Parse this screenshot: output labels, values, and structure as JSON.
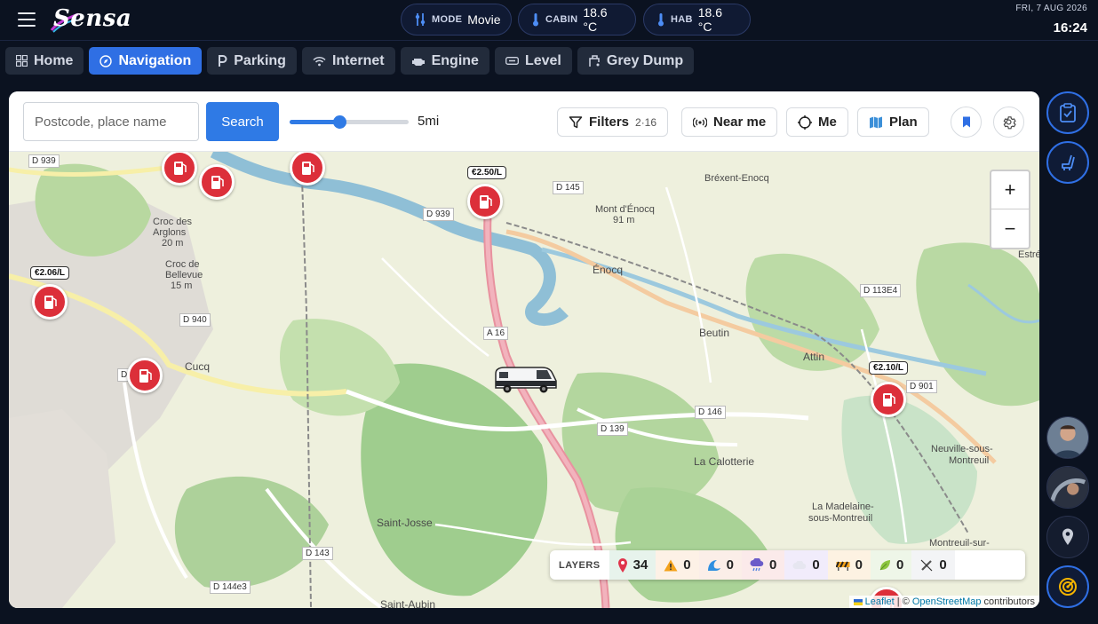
{
  "app": {
    "logo_text": "Sensa"
  },
  "status": {
    "mode_label": "MODE",
    "mode_value": "Movie",
    "cabin_label": "CABIN",
    "cabin_value": "18.6 °C",
    "hab_label": "HAB",
    "hab_value": "18.6 °C",
    "date": "FRI, 7 AUG 2026",
    "time": "16:24"
  },
  "tabs": [
    {
      "label": "Home",
      "icon": "grid-icon"
    },
    {
      "label": "Navigation",
      "icon": "compass-icon",
      "active": true
    },
    {
      "label": "Parking",
      "icon": "parking-icon"
    },
    {
      "label": "Internet",
      "icon": "wifi-icon"
    },
    {
      "label": "Engine",
      "icon": "engine-icon"
    },
    {
      "label": "Level",
      "icon": "level-icon"
    },
    {
      "label": "Grey Dump",
      "icon": "dump-icon"
    }
  ],
  "toolbar": {
    "search_placeholder": "Postcode, place name",
    "search_button": "Search",
    "radius_value": "5mi",
    "radius_fraction": 0.42,
    "filters_label": "Filters",
    "filters_sub": "2·16",
    "near_me_label": "Near me",
    "me_label": "Me",
    "plan_label": "Plan"
  },
  "map": {
    "places": [
      {
        "text": "Bréxent-Enocq"
      },
      {
        "text": "Mont d'Énocq"
      },
      {
        "text": "91 m"
      },
      {
        "text": "Énocq"
      },
      {
        "text": "Croc des"
      },
      {
        "text": "Arglons"
      },
      {
        "text": "20 m"
      },
      {
        "text": "Croc de"
      },
      {
        "text": "Bellevue"
      },
      {
        "text": "15 m"
      },
      {
        "text": "Cucq"
      },
      {
        "text": "Beutin"
      },
      {
        "text": "Attin"
      },
      {
        "text": "La Calotterie"
      },
      {
        "text": "Neuville-sous-"
      },
      {
        "text": "Montreuil"
      },
      {
        "text": "La Madelaine-"
      },
      {
        "text": "sous-Montreuil"
      },
      {
        "text": "Saint-Josse"
      },
      {
        "text": "Saint-Aubin"
      },
      {
        "text": "Montreuil-sur-"
      },
      {
        "text": "Estré"
      }
    ],
    "roads": [
      "D 939",
      "D 145",
      "D 939",
      "D 113E4",
      "A 16",
      "D 940",
      "D 146",
      "D 139",
      "D 901",
      "D 143",
      "D 144e3",
      "D"
    ],
    "prices": [
      "€2.50/L",
      "€2.06/L",
      "€2.10/L"
    ],
    "zoom_in": "+",
    "zoom_out": "−",
    "attribution_leaflet": "Leaflet",
    "attribution_sep": " | © ",
    "attribution_osm": "OpenStreetMap",
    "attribution_tail": " contributors"
  },
  "layers": {
    "title": "LAYERS",
    "items": [
      {
        "count": "34"
      },
      {
        "count": "0"
      },
      {
        "count": "0"
      },
      {
        "count": "0"
      },
      {
        "count": "0"
      },
      {
        "count": "0"
      },
      {
        "count": "0"
      },
      {
        "count": "0"
      }
    ]
  },
  "colors": {
    "accent": "#2f6fe4",
    "pin": "#dc2f3a",
    "background": "#0b1220"
  }
}
